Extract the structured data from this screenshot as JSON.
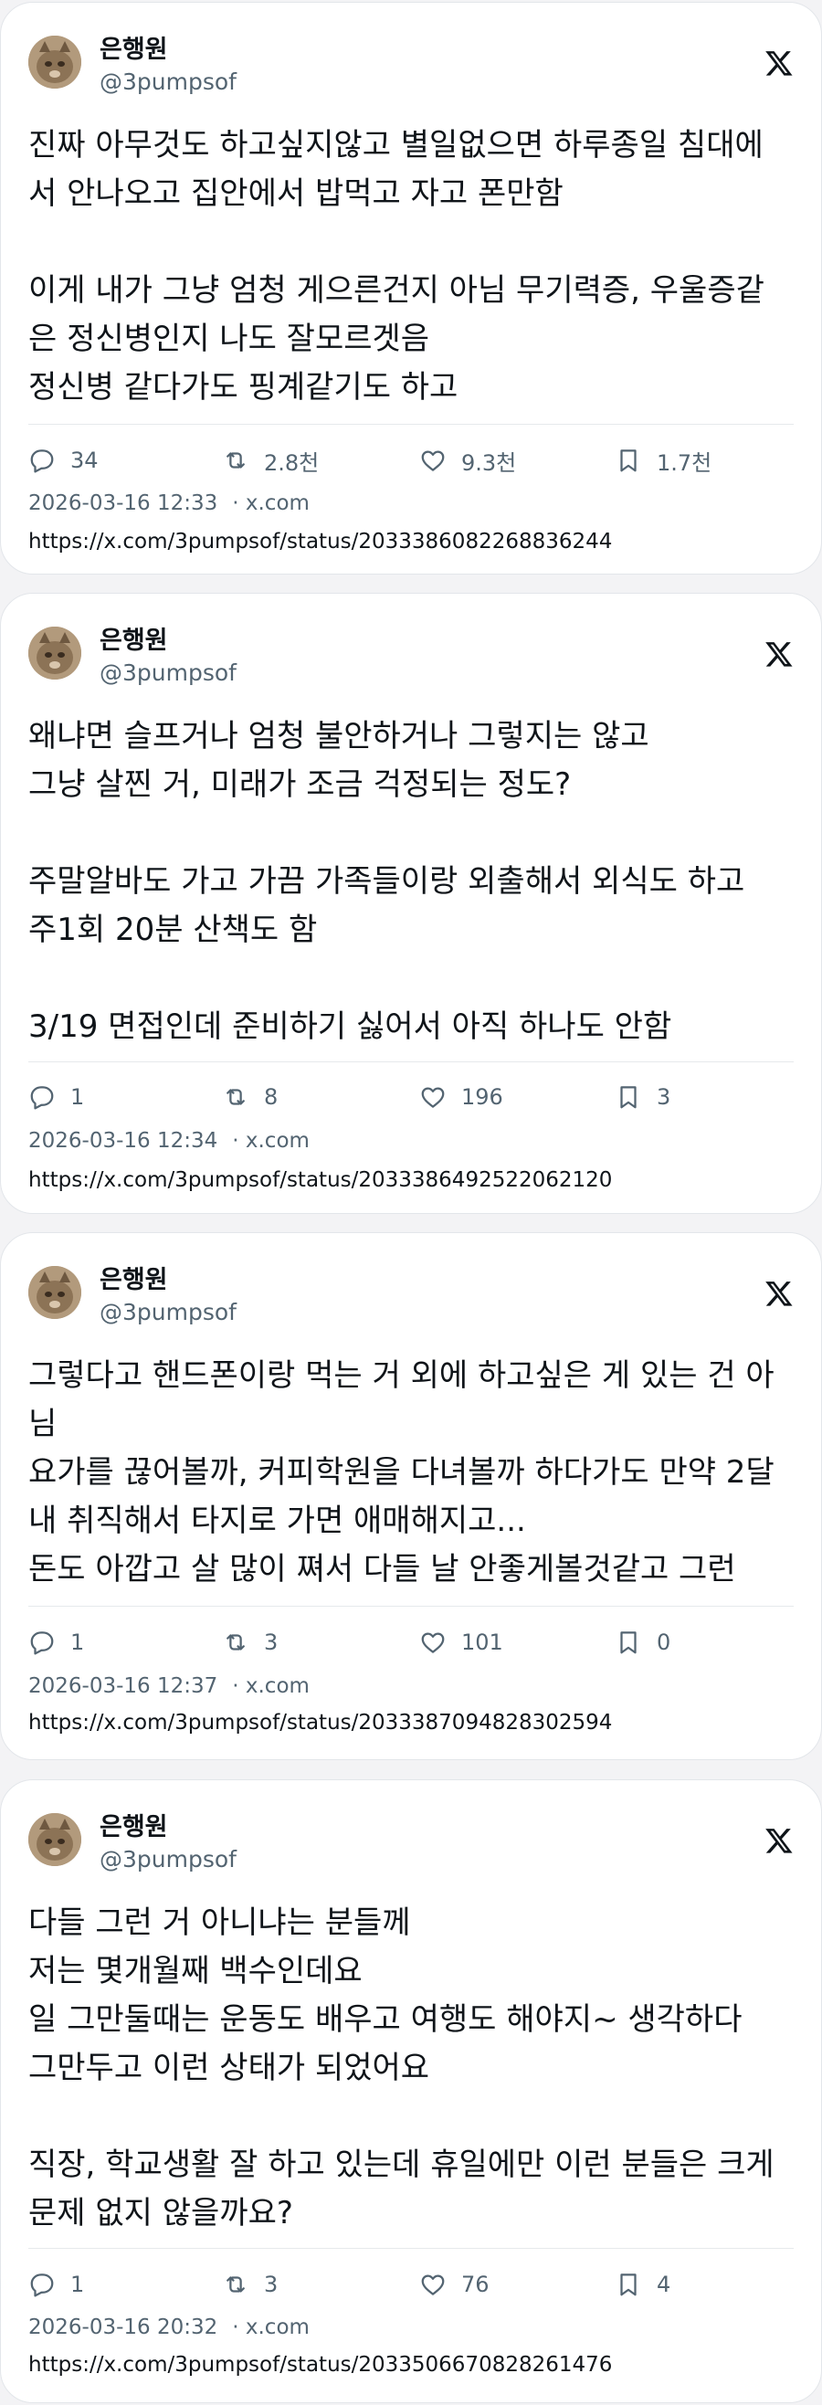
{
  "posts": [
    {
      "author_name": "은행원",
      "handle": "@3pumpsof",
      "text": "진짜 아무것도 하고싶지않고 별일없으면 하루종일 침대에\n서 안나오고 집안에서 밥먹고 자고 폰만함\n\n이게 내가 그냥 엄청 게으른건지 아님 무기력증, 우울증같\n은 정신병인지 나도 잘모르겟음\n정신병 같다가도 핑계같기도 하고",
      "replies": "34",
      "reposts": "2.8천",
      "likes": "9.3천",
      "bookmarks": "1.7천",
      "timestamp": "2026-03-16 12:33",
      "source": "· x.com",
      "url": "https://x.com/3pumpsof/status/2033386082268836244"
    },
    {
      "author_name": "은행원",
      "handle": "@3pumpsof",
      "text": "왜냐면 슬프거나 엄청 불안하거나 그렇지는 않고\n그냥 살찐 거, 미래가 조금 걱정되는 정도?\n\n주말알바도 가고 가끔 가족들이랑 외출해서 외식도 하고\n주1회 20분 산책도 함\n\n3/19 면접인데 준비하기 싫어서 아직 하나도 안함",
      "replies": "1",
      "reposts": "8",
      "likes": "196",
      "bookmarks": "3",
      "timestamp": "2026-03-16 12:34",
      "source": "· x.com",
      "url": "https://x.com/3pumpsof/status/2033386492522062120"
    },
    {
      "author_name": "은행원",
      "handle": "@3pumpsof",
      "text": "그렇다고 핸드폰이랑 먹는 거 외에 하고싶은 게 있는 건 아\n님\n요가를 끊어볼까, 커피학원을 다녀볼까 하다가도 만약 2달\n내 취직해서 타지로 가면 애매해지고...\n돈도 아깝고 살 많이 쪄서 다들 날 안좋게볼것같고 그런",
      "replies": "1",
      "reposts": "3",
      "likes": "101",
      "bookmarks": "0",
      "timestamp": "2026-03-16 12:37",
      "source": "· x.com",
      "url": "https://x.com/3pumpsof/status/2033387094828302594"
    },
    {
      "author_name": "은행원",
      "handle": "@3pumpsof",
      "text": "다들 그런 거 아니냐는 분들께\n저는 몇개월째 백수인데요\n일 그만둘때는 운동도 배우고 여행도 해야지~ 생각하다\n그만두고 이런 상태가 되었어요\n\n직장, 학교생활 잘 하고 있는데 휴일에만 이런 분들은 크게\n문제 없지 않을까요?",
      "replies": "1",
      "reposts": "3",
      "likes": "76",
      "bookmarks": "4",
      "timestamp": "2026-03-16 20:32",
      "source": "· x.com",
      "url": "https://x.com/3pumpsof/status/2033506670828261476"
    }
  ],
  "icons": {
    "reply": "reply-icon",
    "repost": "repost-icon",
    "like": "heart-icon",
    "bookmark": "bookmark-icon",
    "brand": "x-logo-icon"
  },
  "colors": {
    "text": "#0f1419",
    "muted": "#536471",
    "card_bg": "#ffffff",
    "page_bg": "#f3f3f5"
  }
}
